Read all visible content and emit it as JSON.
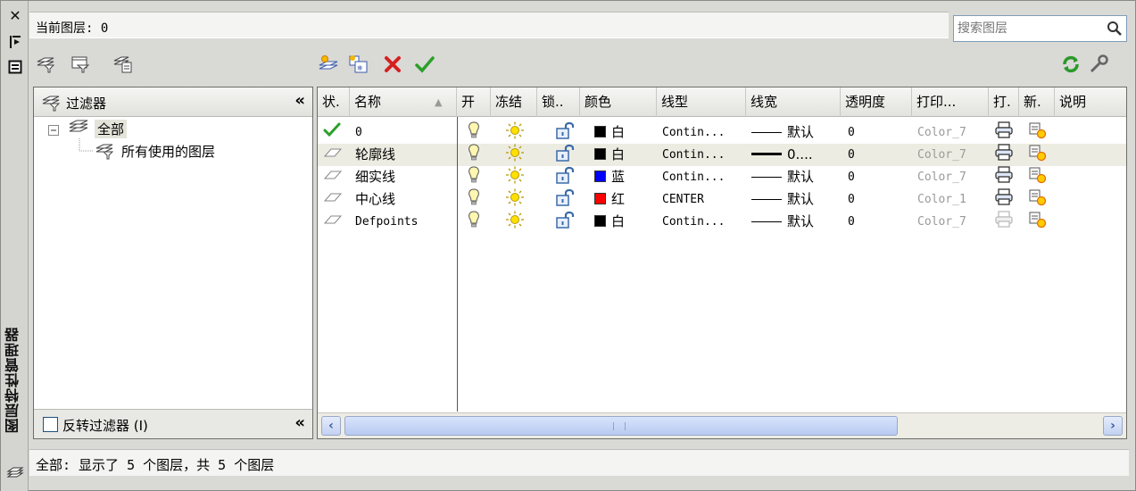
{
  "palette": {
    "title": "图层特性管理器"
  },
  "header": {
    "current_layer": "当前图层: 0",
    "search_placeholder": "搜索图层"
  },
  "filter_tree": {
    "title": "过滤器",
    "root": "全部",
    "child": "所有使用的图层",
    "invert_label": "反转过滤器 (I)"
  },
  "columns": {
    "status": "状.",
    "name": "名称",
    "on": "开",
    "freeze": "冻结",
    "lock": "锁..",
    "color": "颜色",
    "linetype": "线型",
    "lineweight": "线宽",
    "transparency": "透明度",
    "plot_style": "打印...",
    "plot": "打.",
    "new_vp_freeze": "新.",
    "description": "说明"
  },
  "layers": [
    {
      "name": "0",
      "color_name": "白",
      "color_hex": "#000000",
      "linetype": "Contin...",
      "lineweight": "默认",
      "thick": false,
      "transparency": "0",
      "plot_style": "Color_7",
      "plot": true,
      "current": true
    },
    {
      "name": "轮廓线",
      "color_name": "白",
      "color_hex": "#000000",
      "linetype": "Contin...",
      "lineweight": "0....",
      "thick": true,
      "transparency": "0",
      "plot_style": "Color_7",
      "plot": true,
      "current": false
    },
    {
      "name": "细实线",
      "color_name": "蓝",
      "color_hex": "#0000ff",
      "linetype": "Contin...",
      "lineweight": "默认",
      "thick": false,
      "transparency": "0",
      "plot_style": "Color_7",
      "plot": true,
      "current": false
    },
    {
      "name": "中心线",
      "color_name": "红",
      "color_hex": "#ff0000",
      "linetype": "CENTER",
      "lineweight": "默认",
      "thick": false,
      "transparency": "0",
      "plot_style": "Color_1",
      "plot": true,
      "current": false
    },
    {
      "name": "Defpoints",
      "color_name": "白",
      "color_hex": "#000000",
      "linetype": "Contin...",
      "lineweight": "默认",
      "thick": false,
      "transparency": "0",
      "plot_style": "Color_7",
      "plot": false,
      "current": false
    }
  ],
  "status_bar": "全部: 显示了 5 个图层，共 5 个图层"
}
